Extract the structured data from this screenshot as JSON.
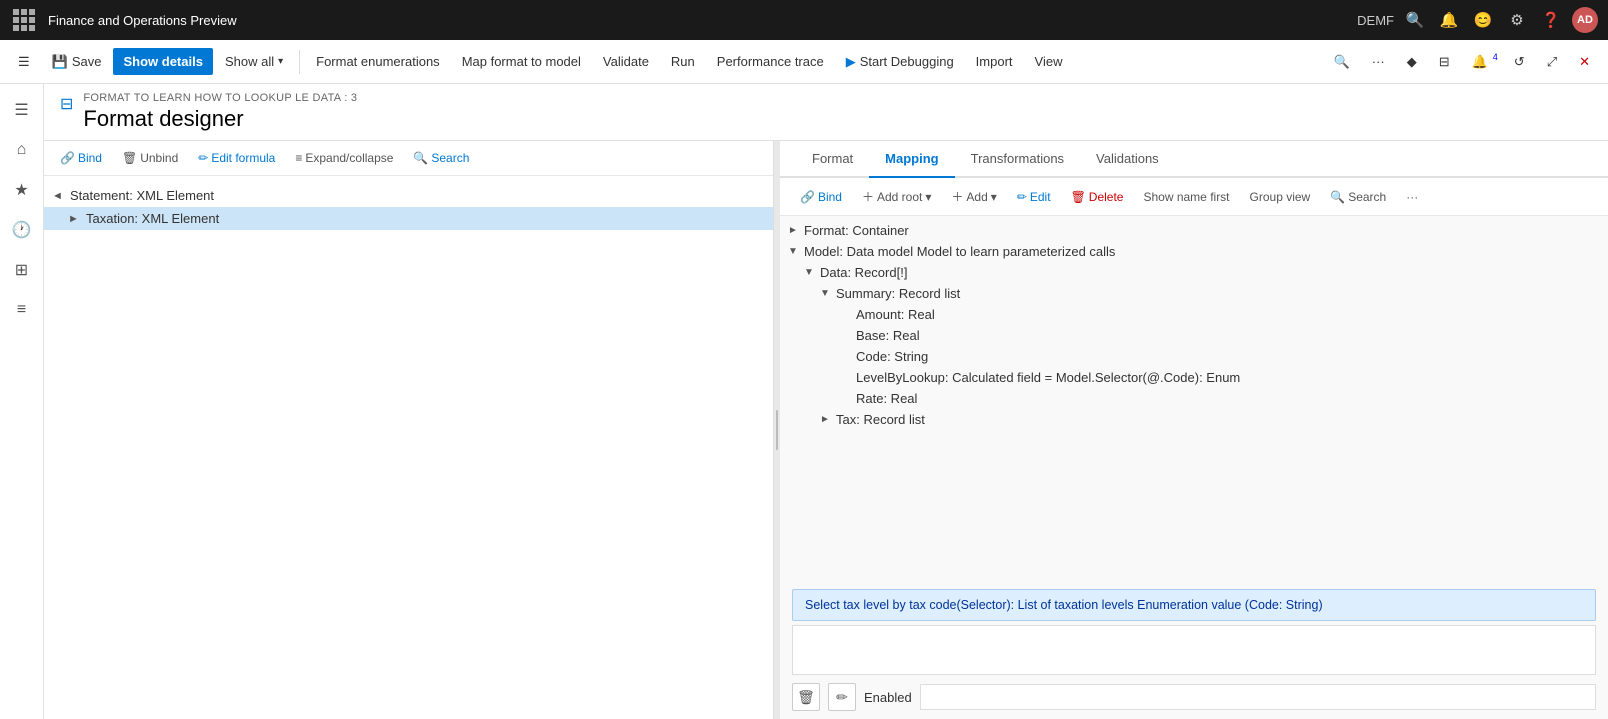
{
  "app": {
    "title": "Finance and Operations Preview",
    "environment": "DEMF"
  },
  "titlebar": {
    "icons": [
      "search",
      "bell",
      "smiley",
      "gear",
      "help"
    ],
    "avatar_label": "AD"
  },
  "commandbar": {
    "save_label": "Save",
    "show_details_label": "Show details",
    "show_all_label": "Show all",
    "show_all_chevron": "▾",
    "format_enumerations_label": "Format enumerations",
    "map_format_to_model_label": "Map format to model",
    "validate_label": "Validate",
    "run_label": "Run",
    "performance_trace_label": "Performance trace",
    "start_debugging_label": "Start Debugging",
    "import_label": "Import",
    "view_label": "View"
  },
  "rail": {
    "items": [
      "menu",
      "home",
      "star",
      "clock",
      "calendar",
      "list"
    ]
  },
  "page": {
    "breadcrumb": "FORMAT TO LEARN HOW TO LOOKUP LE DATA : 3",
    "title": "Format designer"
  },
  "left_pane": {
    "toolbar": {
      "bind_label": "Bind",
      "unbind_label": "Unbind",
      "edit_formula_label": "Edit formula",
      "expand_collapse_label": "Expand/collapse",
      "search_label": "Search"
    },
    "tree": [
      {
        "level": 0,
        "expand": "◄",
        "label": "Statement: XML Element",
        "selected": false
      },
      {
        "level": 1,
        "expand": "►",
        "label": "Taxation: XML Element",
        "selected": true
      }
    ]
  },
  "right_pane": {
    "tabs": [
      {
        "id": "format",
        "label": "Format",
        "active": false
      },
      {
        "id": "mapping",
        "label": "Mapping",
        "active": true
      },
      {
        "id": "transformations",
        "label": "Transformations",
        "active": false
      },
      {
        "id": "validations",
        "label": "Validations",
        "active": false
      }
    ],
    "toolbar": {
      "bind_label": "Bind",
      "add_root_label": "Add root",
      "add_root_chevron": "▾",
      "add_label": "Add",
      "add_chevron": "▾",
      "edit_label": "Edit",
      "delete_label": "Delete",
      "show_name_first_label": "Show name first",
      "group_view_label": "Group view",
      "search_label": "Search",
      "more_label": "···"
    },
    "model_tree": [
      {
        "level": 0,
        "expand": "►",
        "label": "Format: Container",
        "indent": 0
      },
      {
        "level": 0,
        "expand": "▼",
        "label": "Model: Data model Model to learn parameterized calls",
        "indent": 0
      },
      {
        "level": 1,
        "expand": "▼",
        "label": "Data: Record[!]",
        "indent": 1
      },
      {
        "level": 2,
        "expand": "▼",
        "label": "Summary: Record list",
        "indent": 2
      },
      {
        "level": 3,
        "expand": "",
        "label": "Amount: Real",
        "indent": 3
      },
      {
        "level": 3,
        "expand": "",
        "label": "Base: Real",
        "indent": 3
      },
      {
        "level": 3,
        "expand": "",
        "label": "Code: String",
        "indent": 3
      },
      {
        "level": 3,
        "expand": "",
        "label": "LevelByLookup: Calculated field = Model.Selector(@.Code): Enum",
        "indent": 3
      },
      {
        "level": 3,
        "expand": "",
        "label": "Rate: Real",
        "indent": 3
      },
      {
        "level": 2,
        "expand": "►",
        "label": "Tax: Record list",
        "indent": 2
      }
    ],
    "selected_formula": "Select tax level by tax code(Selector): List of taxation levels Enumeration value (Code: String)",
    "formula_placeholder": "",
    "enabled_label": "Enabled",
    "enabled_value": ""
  }
}
